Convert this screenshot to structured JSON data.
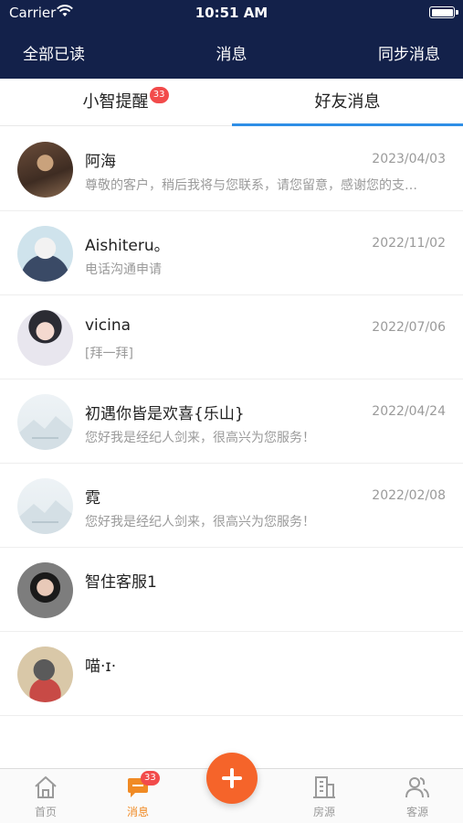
{
  "status_bar": {
    "carrier": "Carrier",
    "time": "10:51 AM"
  },
  "nav": {
    "left": "全部已读",
    "title": "消息",
    "right": "同步消息"
  },
  "tabs": [
    {
      "label": "小智提醒",
      "badge": "33",
      "active": false
    },
    {
      "label": "好友消息",
      "active": true
    }
  ],
  "conversations": [
    {
      "name": "阿海",
      "date": "2023/04/03",
      "preview": "尊敬的客户，稍后我将与您联系，请您留意，感谢您的支…"
    },
    {
      "name": "Aishiteru。",
      "date": "2022/11/02",
      "preview": "电话沟通申请"
    },
    {
      "name": "vicina",
      "date": "2022/07/06",
      "preview": "[拜一拜]"
    },
    {
      "name": "初遇你皆是欢喜{乐山}",
      "date": "2022/04/24",
      "preview": "您好我是经纪人剑来，很高兴为您服务！"
    },
    {
      "name": "霓",
      "date": "2022/02/08",
      "preview": "您好我是经纪人剑来，很高兴为您服务！"
    },
    {
      "name": "智住客服1",
      "date": "",
      "preview": ""
    },
    {
      "name": "喵·ɪ·",
      "date": "",
      "preview": ""
    }
  ],
  "tabbar": {
    "home": "首页",
    "messages": "消息",
    "messages_badge": "33",
    "listings": "房源",
    "clients": "客源"
  },
  "colors": {
    "header_bg": "#13214a",
    "accent_blue": "#2f8ee6",
    "accent_orange": "#f08a24",
    "badge_red": "#f24b4b",
    "fab": "#f5642a"
  }
}
